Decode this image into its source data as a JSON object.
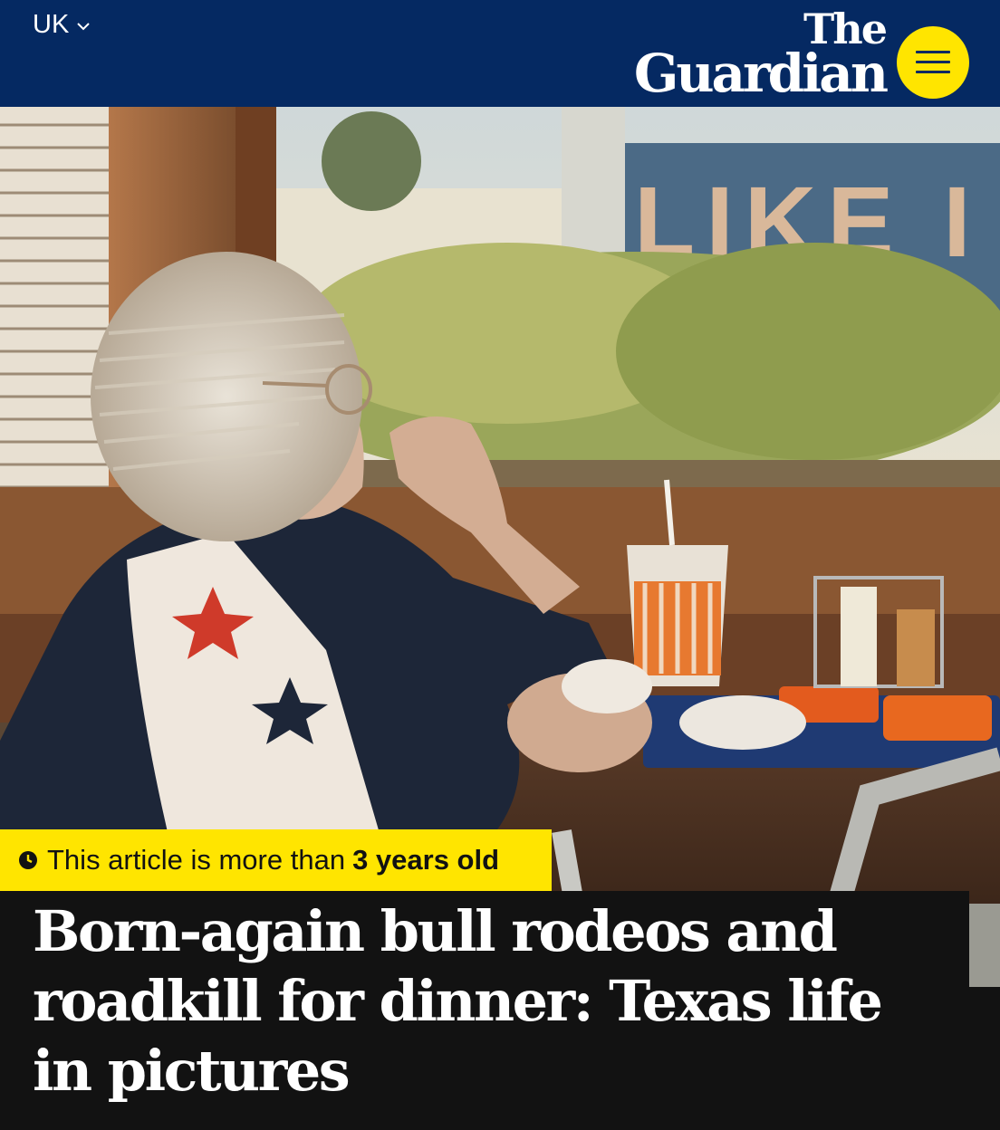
{
  "header": {
    "edition_label": "UK",
    "logo_line1": "The",
    "logo_line2": "Guardian",
    "menu_icon": "hamburger-icon",
    "colors": {
      "background": "#052962",
      "menu_button": "#ffe500"
    }
  },
  "hero": {
    "window_lettering": "LIKE I"
  },
  "article": {
    "age_prefix": "This article is more than",
    "age_value": "3 years old",
    "age_icon": "clock-icon",
    "headline": "Born-again bull rodeos and roadkill for dinner: Texas life in pictures",
    "colors": {
      "badge": "#ffe500",
      "headline_bg": "#121212"
    }
  }
}
